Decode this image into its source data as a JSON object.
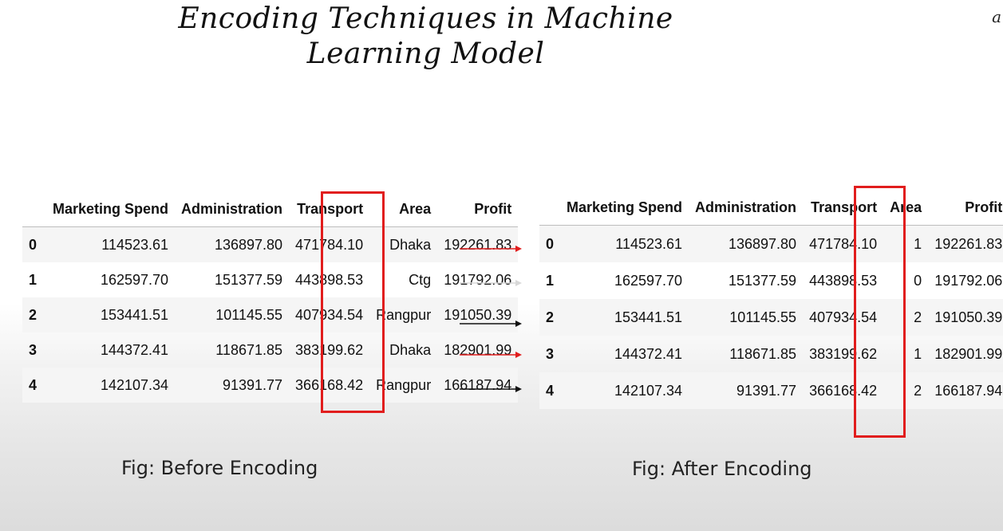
{
  "title": {
    "line1": "Encoding Techniques in Machine",
    "line2": "Learning Model"
  },
  "corner_note": "a",
  "columns": [
    "",
    "Marketing Spend",
    "Administration",
    "Transport",
    "Area",
    "Profit"
  ],
  "before": {
    "rows": [
      [
        "0",
        "114523.61",
        "136897.80",
        "471784.10",
        "Dhaka",
        "192261.83"
      ],
      [
        "1",
        "162597.70",
        "151377.59",
        "443898.53",
        "Ctg",
        "191792.06"
      ],
      [
        "2",
        "153441.51",
        "101145.55",
        "407934.54",
        "Rangpur",
        "191050.39"
      ],
      [
        "3",
        "144372.41",
        "118671.85",
        "383199.62",
        "Dhaka",
        "182901.99"
      ],
      [
        "4",
        "142107.34",
        "91391.77",
        "366168.42",
        "Rangpur",
        "166187.94"
      ]
    ],
    "caption": "Fig: Before Encoding"
  },
  "after": {
    "rows": [
      [
        "0",
        "114523.61",
        "136897.80",
        "471784.10",
        "1",
        "192261.83"
      ],
      [
        "1",
        "162597.70",
        "151377.59",
        "443898.53",
        "0",
        "191792.06"
      ],
      [
        "2",
        "153441.51",
        "101145.55",
        "407934.54",
        "2",
        "191050.39"
      ],
      [
        "3",
        "144372.41",
        "118671.85",
        "383199.62",
        "1",
        "182901.99"
      ],
      [
        "4",
        "142107.34",
        "91391.77",
        "366168.42",
        "2",
        "166187.94"
      ]
    ],
    "caption": "Fig: After Encoding"
  },
  "colors": {
    "highlight": "#e11d1d",
    "arrow_red": "#e11d1d",
    "arrow_black": "#111111",
    "arrow_light": "#d8d8d8"
  },
  "arrows": [
    "red",
    "light",
    "black",
    "red",
    "black"
  ]
}
